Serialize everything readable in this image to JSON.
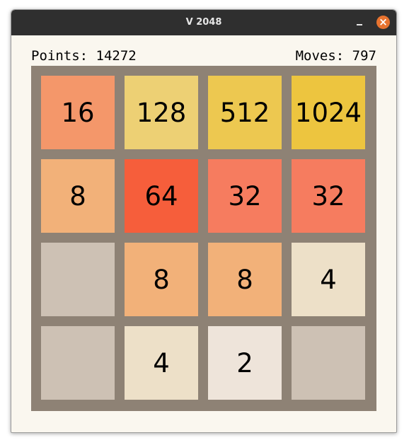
{
  "window": {
    "title": "V 2048",
    "close_glyph": "×",
    "minimize_icon": "minimize-icon",
    "close_icon": "close-icon"
  },
  "stats": {
    "points_text": "Points: 14272",
    "moves_text": "Moves: 797"
  },
  "board": {
    "rows": 4,
    "cols": 4,
    "tiles": [
      [
        {
          "label": "16",
          "color": "#f4976a"
        },
        {
          "label": "128",
          "color": "#edd074"
        },
        {
          "label": "512",
          "color": "#edc850"
        },
        {
          "label": "1024",
          "color": "#edc53f"
        }
      ],
      [
        {
          "label": "8",
          "color": "#f2b179"
        },
        {
          "label": "64",
          "color": "#f65e3b"
        },
        {
          "label": "32",
          "color": "#f67c5f"
        },
        {
          "label": "32",
          "color": "#f67c5f"
        }
      ],
      [
        {
          "label": "",
          "color": "#cdc1b4"
        },
        {
          "label": "8",
          "color": "#f2b179"
        },
        {
          "label": "8",
          "color": "#f2b179"
        },
        {
          "label": "4",
          "color": "#ede0c8"
        }
      ],
      [
        {
          "label": "",
          "color": "#cdc1b4"
        },
        {
          "label": "4",
          "color": "#ede0c8"
        },
        {
          "label": "2",
          "color": "#eee4da"
        },
        {
          "label": "",
          "color": "#cdc1b4"
        }
      ]
    ]
  }
}
